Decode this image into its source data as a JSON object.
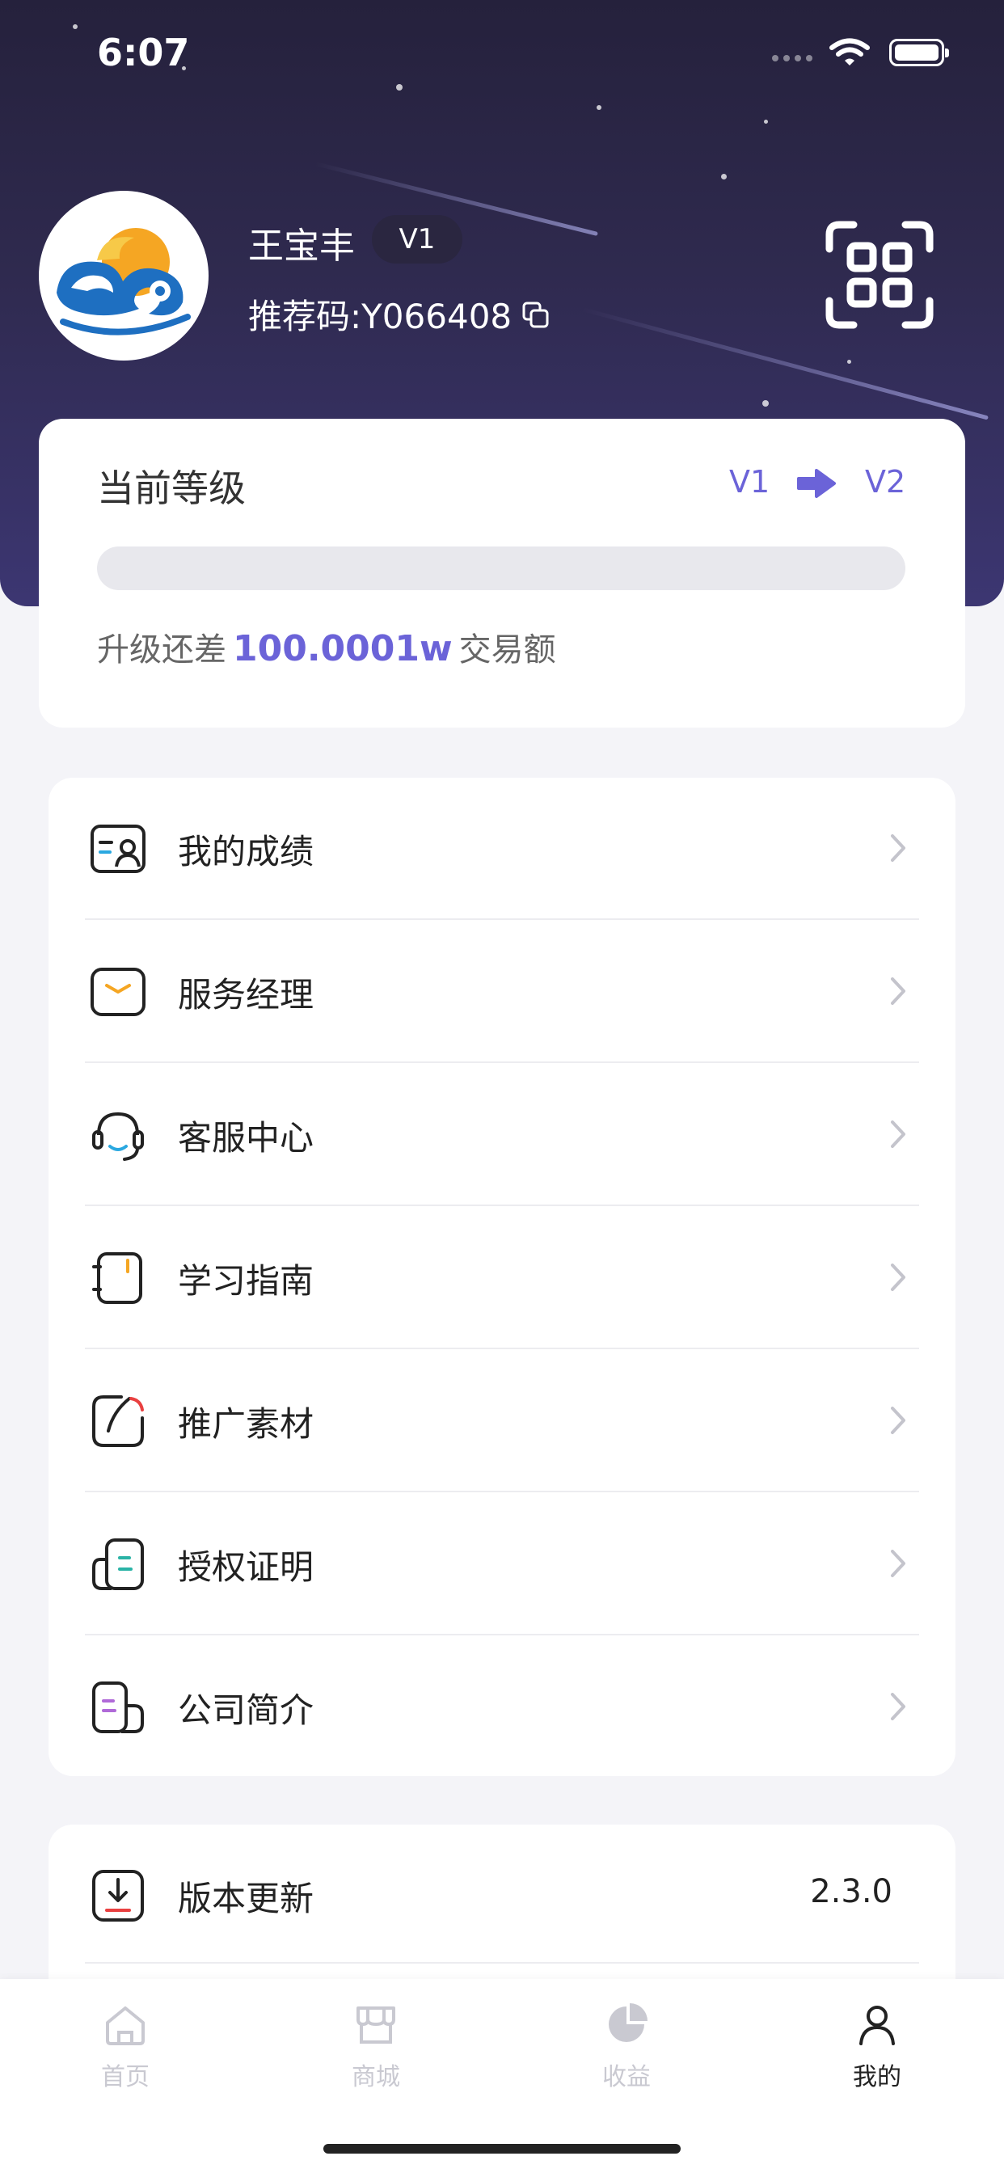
{
  "status_bar": {
    "time": "6:07"
  },
  "profile": {
    "name": "王宝丰",
    "level": "V1",
    "referral_label": "推荐码:Y066408"
  },
  "level_card": {
    "title": "当前等级",
    "current_level": "V1",
    "next_level": "V2",
    "progress": 0,
    "need_prefix": "升级还差",
    "need_amount": "100.0001w",
    "need_suffix": "交易额"
  },
  "menu": {
    "items": [
      {
        "label": "我的成绩",
        "icon": "achievement-icon"
      },
      {
        "label": "服务经理",
        "icon": "message-icon"
      },
      {
        "label": "客服中心",
        "icon": "headset-icon"
      },
      {
        "label": "学习指南",
        "icon": "notebook-icon"
      },
      {
        "label": "推广素材",
        "icon": "promo-icon"
      },
      {
        "label": "授权证明",
        "icon": "certificate-icon"
      },
      {
        "label": "公司简介",
        "icon": "company-icon"
      }
    ]
  },
  "update": {
    "label": "版本更新",
    "version": "2.3.0",
    "icon": "download-icon"
  },
  "tabbar": {
    "tabs": [
      {
        "label": "首页",
        "icon": "home-icon",
        "active": false
      },
      {
        "label": "商城",
        "icon": "store-icon",
        "active": false
      },
      {
        "label": "收益",
        "icon": "pie-chart-icon",
        "active": false
      },
      {
        "label": "我的",
        "icon": "user-icon",
        "active": true
      }
    ]
  },
  "colors": {
    "accent": "#6b63d8",
    "header_dark": "#25213c",
    "header_light": "#3c3672"
  }
}
